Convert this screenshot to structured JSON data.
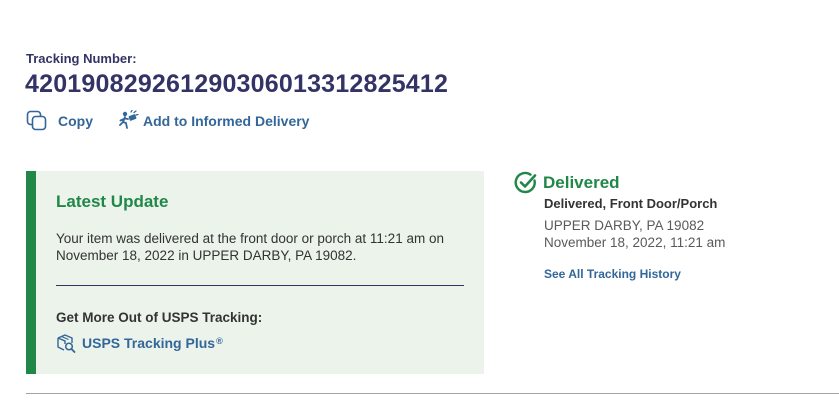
{
  "tracking": {
    "label": "Tracking Number:",
    "number": "420190829261290306013312825412"
  },
  "actions": {
    "copy_label": "Copy",
    "copy_icon": "copy-icon",
    "informed_label": "Add to Informed Delivery",
    "informed_icon": "mail-carrier-icon"
  },
  "latest_update": {
    "title": "Latest Update",
    "message": "Your item was delivered at the front door or porch at 11:21 am on November 18, 2022 in UPPER DARBY, PA 19082.",
    "more_title": "Get More Out of USPS Tracking:",
    "plus_label": "USPS Tracking Plus",
    "plus_mark": "®",
    "plus_icon": "package-search-icon"
  },
  "status": {
    "title": "Delivered",
    "subtitle": "Delivered, Front Door/Porch",
    "location": "UPPER DARBY, PA 19082",
    "datetime": "November 18, 2022, 11:21 am",
    "history_link": "See All Tracking History",
    "icon": "check-circle-icon"
  },
  "colors": {
    "navy": "#333366",
    "link": "#336699",
    "green": "#218748",
    "card_bg": "#ebf3eb",
    "text": "#333333",
    "muted": "#595959"
  }
}
